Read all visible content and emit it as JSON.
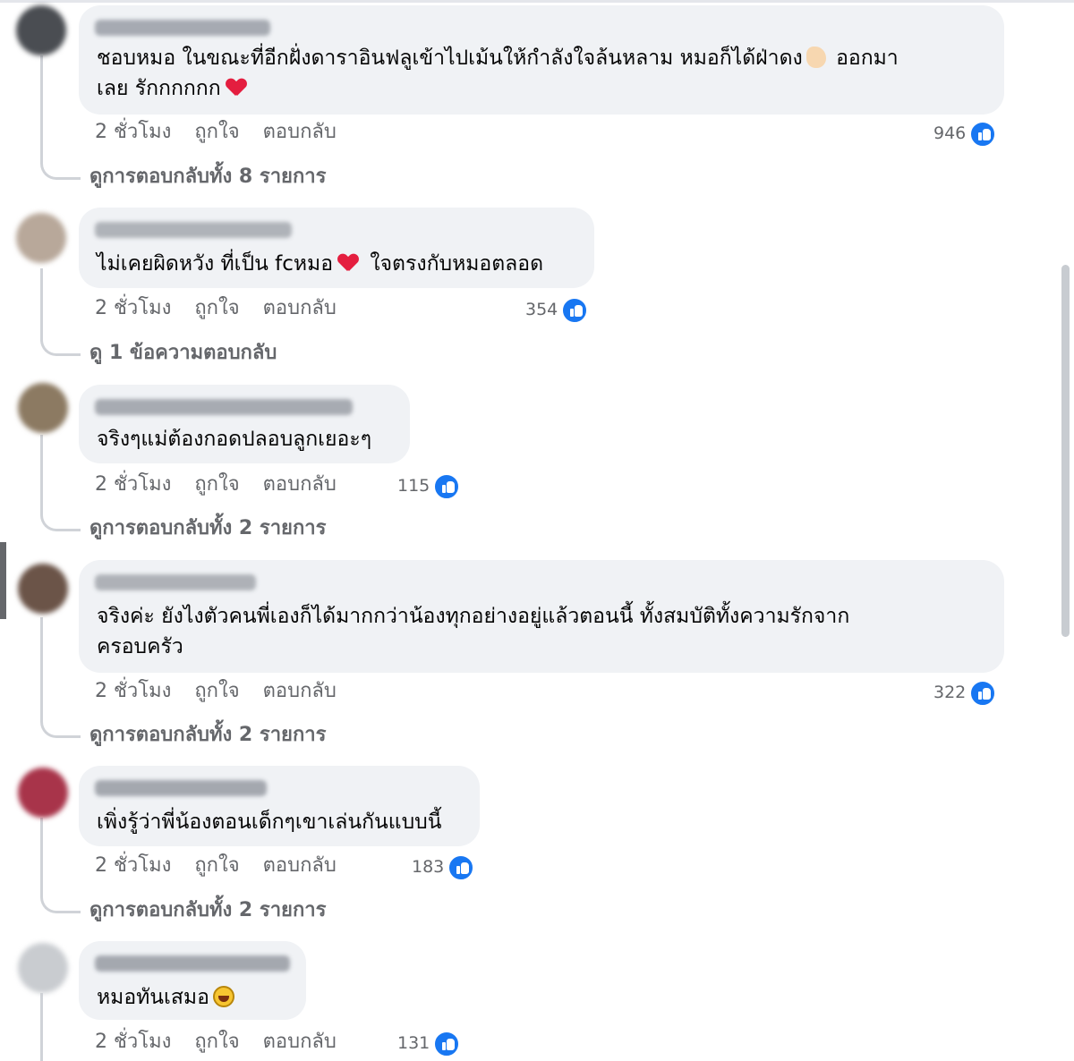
{
  "action_labels": {
    "time": "2 ชั่วโมง",
    "like": "ถูกใจ",
    "reply": "ตอบกลับ"
  },
  "colors": {
    "accent": "#1877f2",
    "bubble": "#f0f2f5",
    "secondary_text": "#65676b",
    "heart": "#e41e3f"
  },
  "comments": [
    {
      "lines": [
        "ชอบหมอ ในขณะที่อีกฝั่งดาราอินฟลูเข้าไปเม้นให้กำลังใจล้นหลาม หมอก็ได้ฝ่าดง",
        "เลย รักกกกกก"
      ],
      "line2_extra": "ออกมา",
      "reaction_count": "946",
      "view_replies": "ดูการตอบกลับทั้ง 8 รายการ"
    },
    {
      "text_before": "ไม่เคยผิดหวัง ที่เป็น fcหมอ",
      "text_after": "ใจตรงกับหมอตลอด",
      "reaction_count": "354",
      "view_replies": "ดู 1 ข้อความตอบกลับ"
    },
    {
      "text": "จริงๆแม่ต้องกอดปลอบลูกเยอะๆ",
      "reaction_count": "115",
      "view_replies": "ดูการตอบกลับทั้ง 2 รายการ"
    },
    {
      "lines": [
        "จริงค่ะ ยังไงตัวคนพี่เองก็ได้มากกว่าน้องทุกอย่างอยู่แล้วตอนนี้ ทั้งสมบัติทั้งความรักจาก",
        "ครอบครัว"
      ],
      "reaction_count": "322",
      "view_replies": "ดูการตอบกลับทั้ง 2 รายการ"
    },
    {
      "text": "เพิ่งรู้ว่าพี่น้องตอนเด็กๆเขาเล่นกันแบบนี้",
      "reaction_count": "183",
      "view_replies": "ดูการตอบกลับทั้ง 2 รายการ"
    },
    {
      "text": "หมอทันเสมอ",
      "reaction_count": "131"
    }
  ]
}
